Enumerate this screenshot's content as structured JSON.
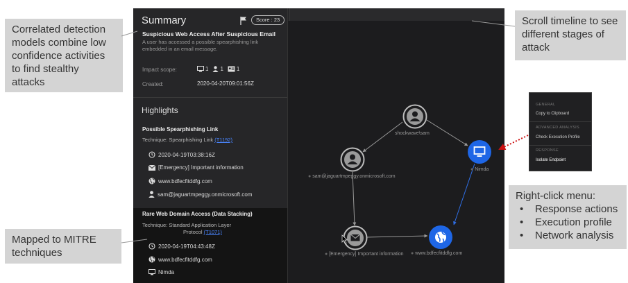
{
  "callouts": {
    "correlated": [
      "Correlated detection",
      "models combine low",
      "confidence activities",
      "to find stealthy",
      "attacks"
    ],
    "scroll": [
      "Scroll timeline to see",
      "different stages of",
      "attack"
    ],
    "rightclick": {
      "title": "Right-click menu:",
      "bullets": [
        "Response actions",
        "Execution profile",
        "Network analysis"
      ]
    },
    "mitre": [
      "Mapped to MITRE",
      "techniques"
    ]
  },
  "summary": {
    "title": "Summary",
    "score": "Score : 23",
    "alert_title": "Suspicious Web Access After Suspicious Email",
    "alert_desc": "A user has accessed a possible spearphishing link embedded in an email message.",
    "impact_label": "Impact scope:",
    "impact_counts": [
      "1",
      "1",
      "1"
    ],
    "created_label": "Created:",
    "created_value": "2020-04-20T09:01:56Z"
  },
  "highlights": {
    "title": "Highlights",
    "items": [
      {
        "title": "Possible Spearphishing Link",
        "technique_label": "Technique:",
        "technique": "Spearphishing Link",
        "technique_id": "(T1192)",
        "rows": [
          "2020-04-19T03:38:16Z",
          "[Emergency] Important information",
          "www.bdfecfitddfg.com",
          "sam@jaguartmpeggy.onmicrosoft.com"
        ]
      },
      {
        "title": "Rare Web Domain Access (Data Stacking)",
        "technique_label": "Technique:",
        "technique": "Standard Application Layer",
        "technique_cont": "Protocol",
        "technique_id": "(T1071)",
        "rows": [
          "2020-04-19T04:43:48Z",
          "www.bdfecfitddfg.com",
          "Nimda"
        ]
      }
    ]
  },
  "graph": {
    "nodes": {
      "shockwave": "shockwave\\sam",
      "sam": "sam@jaguartmpeggy.onmicrosoft.com",
      "nimda": "Nimda",
      "email": "[Emergency] Important information",
      "web": "www.bdfecfitddfg.com"
    }
  },
  "context_menu": {
    "general_header": "GENERAL",
    "copy": "Copy to Clipboard",
    "advanced_header": "ADVANCED ANALYSIS",
    "exec_profile": "Check Execution Profile",
    "response_header": "RESPONSE",
    "isolate": "Isolate Endpoint"
  },
  "colors": {
    "accent_blue": "#1e66e6",
    "link_blue": "#4a86ff",
    "dotted_arrow_red": "#cc1111"
  }
}
